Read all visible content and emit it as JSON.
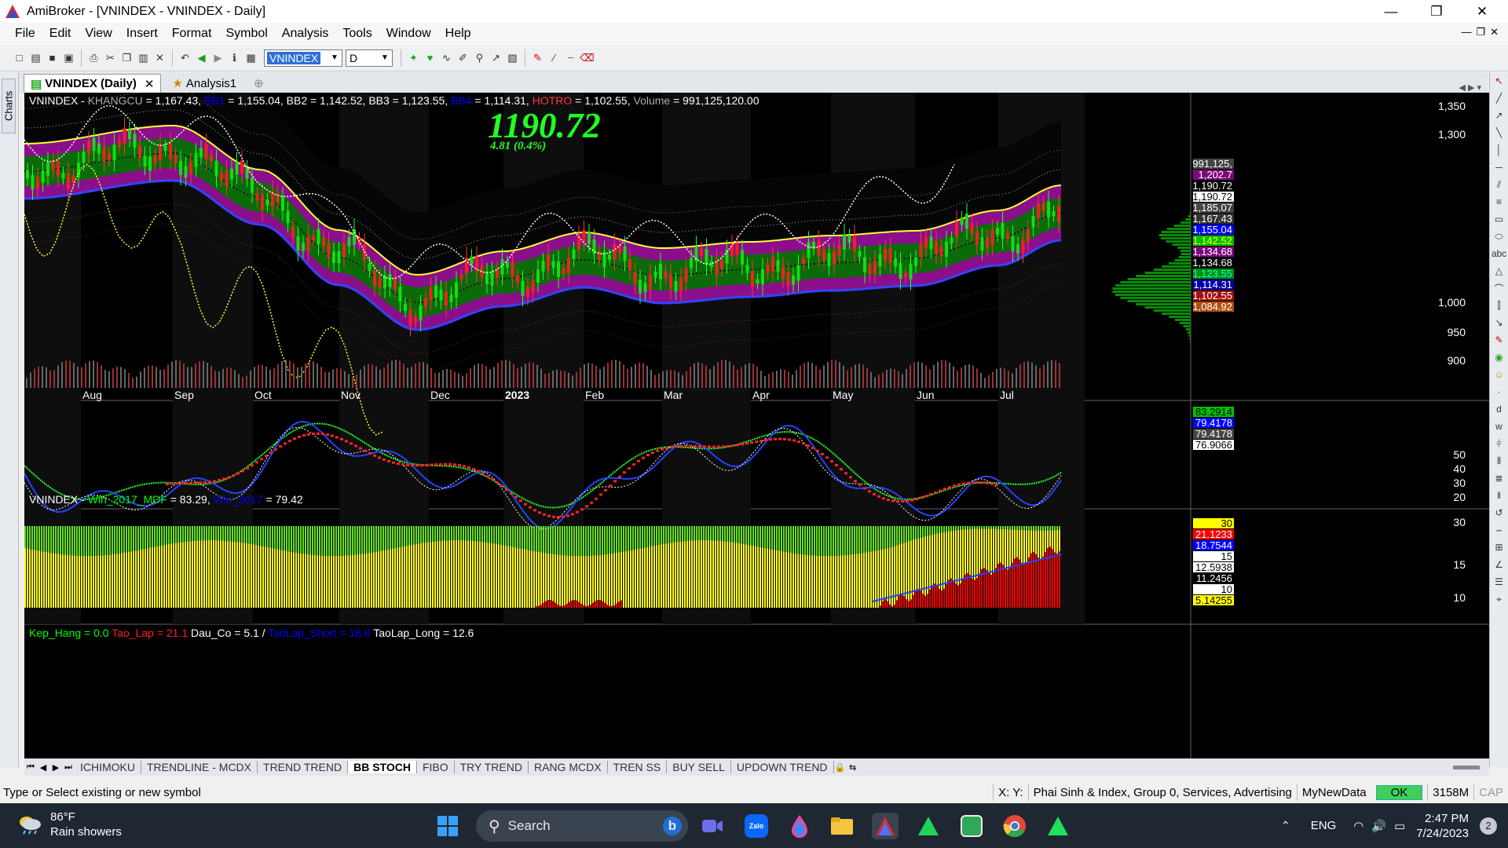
{
  "window": {
    "title": "AmiBroker - [VNINDEX - VNINDEX - Daily]"
  },
  "menu": [
    "File",
    "Edit",
    "View",
    "Insert",
    "Format",
    "Symbol",
    "Analysis",
    "Tools",
    "Window",
    "Help"
  ],
  "toolbar": {
    "symbol": "VNINDEX",
    "interval": "D"
  },
  "left_tab": "Charts",
  "doc_tabs": [
    {
      "label": "VNINDEX (Daily)",
      "active": true
    },
    {
      "label": "Analysis1",
      "active": false
    }
  ],
  "main_legend": [
    {
      "text": "VNINDEX - ",
      "color": "#ffffff"
    },
    {
      "text": "KHANGCU",
      "color": "#aaaaaa"
    },
    {
      "text": " = 1,167.43, ",
      "color": "#ffffff"
    },
    {
      "text": "BB1",
      "color": "#0000ff"
    },
    {
      "text": " = 1,155.04, BB2  = 1,142.52, BB3 = 1,123.55, ",
      "color": "#ffffff"
    },
    {
      "text": "BB4",
      "color": "#0000ff"
    },
    {
      "text": " = 1,114.31, ",
      "color": "#ffffff"
    },
    {
      "text": "HOTRO",
      "color": "#ff3a3a"
    },
    {
      "text": " = 1,102.55, ",
      "color": "#ffffff"
    },
    {
      "text": "Volume",
      "color": "#aaaaaa"
    },
    {
      "text": " = 991,125,120.00",
      "color": "#ffffff"
    }
  ],
  "last_price": "1190.72",
  "last_change": "4.81 (0.4%)",
  "x_axis": [
    "Aug",
    "Sep",
    "Oct",
    "Nov",
    "Dec",
    "2023",
    "Feb",
    "Mar",
    "Apr",
    "May",
    "Jun",
    "Jul"
  ],
  "price_axis": [
    "1,350",
    "1,300",
    "1,000",
    "950",
    "900"
  ],
  "price_labels": [
    {
      "text": "991,125,",
      "bg": "#444444",
      "fg": "#ffffff"
    },
    {
      "text": "1,202.7",
      "bg": "#7a0a7a",
      "fg": "#ffffff"
    },
    {
      "text": "1,190.72",
      "bg": "#000000",
      "fg": "#ffffff"
    },
    {
      "text": "1,190.72",
      "bg": "#ffffff",
      "fg": "#000000"
    },
    {
      "text": "1,185.07",
      "bg": "#444444",
      "fg": "#ffffff"
    },
    {
      "text": "1,167.43",
      "bg": "#333333",
      "fg": "#ffffff"
    },
    {
      "text": "1,155.04",
      "bg": "#0000ff",
      "fg": "#ffffff"
    },
    {
      "text": "1,142.52",
      "bg": "#00c000",
      "fg": "#ffff00"
    },
    {
      "text": "1,134.68",
      "bg": "#7a0a7a",
      "fg": "#ffffff"
    },
    {
      "text": "1,134.68",
      "bg": "#000000",
      "fg": "#ffffff"
    },
    {
      "text": "1,123.55",
      "bg": "#009000",
      "fg": "#00ffff"
    },
    {
      "text": "1,114.31",
      "bg": "#0000aa",
      "fg": "#ffffff"
    },
    {
      "text": "1,102.55",
      "bg": "#a01010",
      "fg": "#ffffff"
    },
    {
      "text": "1,084.92",
      "bg": "#b05010",
      "fg": "#ffffff"
    }
  ],
  "mid_legend": [
    {
      "text": "VNINDEX - ",
      "color": "#ffffff"
    },
    {
      "text": "Win_2017_MDF",
      "color": "#00ff00"
    },
    {
      "text": " = 83.29, ",
      "color": "#ffffff"
    },
    {
      "text": "Win_2017",
      "color": "#0000ff"
    },
    {
      "text": " = 79.42",
      "color": "#ffffff"
    }
  ],
  "mid_axis": [
    "50",
    "40",
    "30",
    "20"
  ],
  "mid_labels": [
    {
      "text": "83.2914",
      "bg": "#00c000",
      "fg": "#000000"
    },
    {
      "text": "79.4178",
      "bg": "#0000ff",
      "fg": "#ffffff"
    },
    {
      "text": "79.4178",
      "bg": "#444444",
      "fg": "#ffffff"
    },
    {
      "text": "76.9066",
      "bg": "#ffffff",
      "fg": "#000000"
    }
  ],
  "low_legend": [
    {
      "text": "Kep_Hang = 0.0  ",
      "color": "#00ff00"
    },
    {
      "text": "Tao_Lap = 21.1  ",
      "color": "#ff2020"
    },
    {
      "text": "Dau_Co = 5.1   ",
      "color": "#ffffff"
    },
    {
      "text": "/ ",
      "color": "#ffffff"
    },
    {
      "text": "TaoLap_Short = 18.8  ",
      "color": "#0000ff"
    },
    {
      "text": "TaoLap_Long = 12.6",
      "color": "#ffffff"
    }
  ],
  "low_axis": [
    "30",
    "15",
    "10"
  ],
  "low_labels": [
    {
      "text": "30",
      "bg": "#ffff00",
      "fg": "#000000"
    },
    {
      "text": "21.1233",
      "bg": "#ff0000",
      "fg": "#ffffff"
    },
    {
      "text": "18.7544",
      "bg": "#0000ff",
      "fg": "#ffffff"
    },
    {
      "text": "15",
      "bg": "#ffffff",
      "fg": "#000000"
    },
    {
      "text": "12.5938",
      "bg": "#ffffff",
      "fg": "#000000"
    },
    {
      "text": "11.2456",
      "bg": "#000000",
      "fg": "#ffffff"
    },
    {
      "text": "10",
      "bg": "#ffffff",
      "fg": "#000000"
    },
    {
      "text": "5.14255",
      "bg": "#ffff00",
      "fg": "#000000"
    }
  ],
  "sheet_tabs": [
    "ICHIMOKU",
    "TRENDLINE - MCDX",
    "TREND TREND",
    "BB STOCH",
    "FIBO",
    "TRY TREND",
    "RANG MCDX",
    "TREN SS",
    "BUY SELL",
    "UPDOWN TREND"
  ],
  "active_sheet": "BB STOCH",
  "status": {
    "hint": "Type or Select existing or new symbol",
    "xy": "X:  Y:",
    "category": "Phai Sinh & Index, Group 0, Services, Advertising",
    "db": "MyNewData",
    "ok": "OK",
    "mem": "3158M",
    "cap": "CAP"
  },
  "taskbar": {
    "temp": "86°F",
    "weather": "Rain showers",
    "search": "Search",
    "lang": "ENG",
    "time": "2:47 PM",
    "date": "7/24/2023",
    "badge": "2"
  }
}
